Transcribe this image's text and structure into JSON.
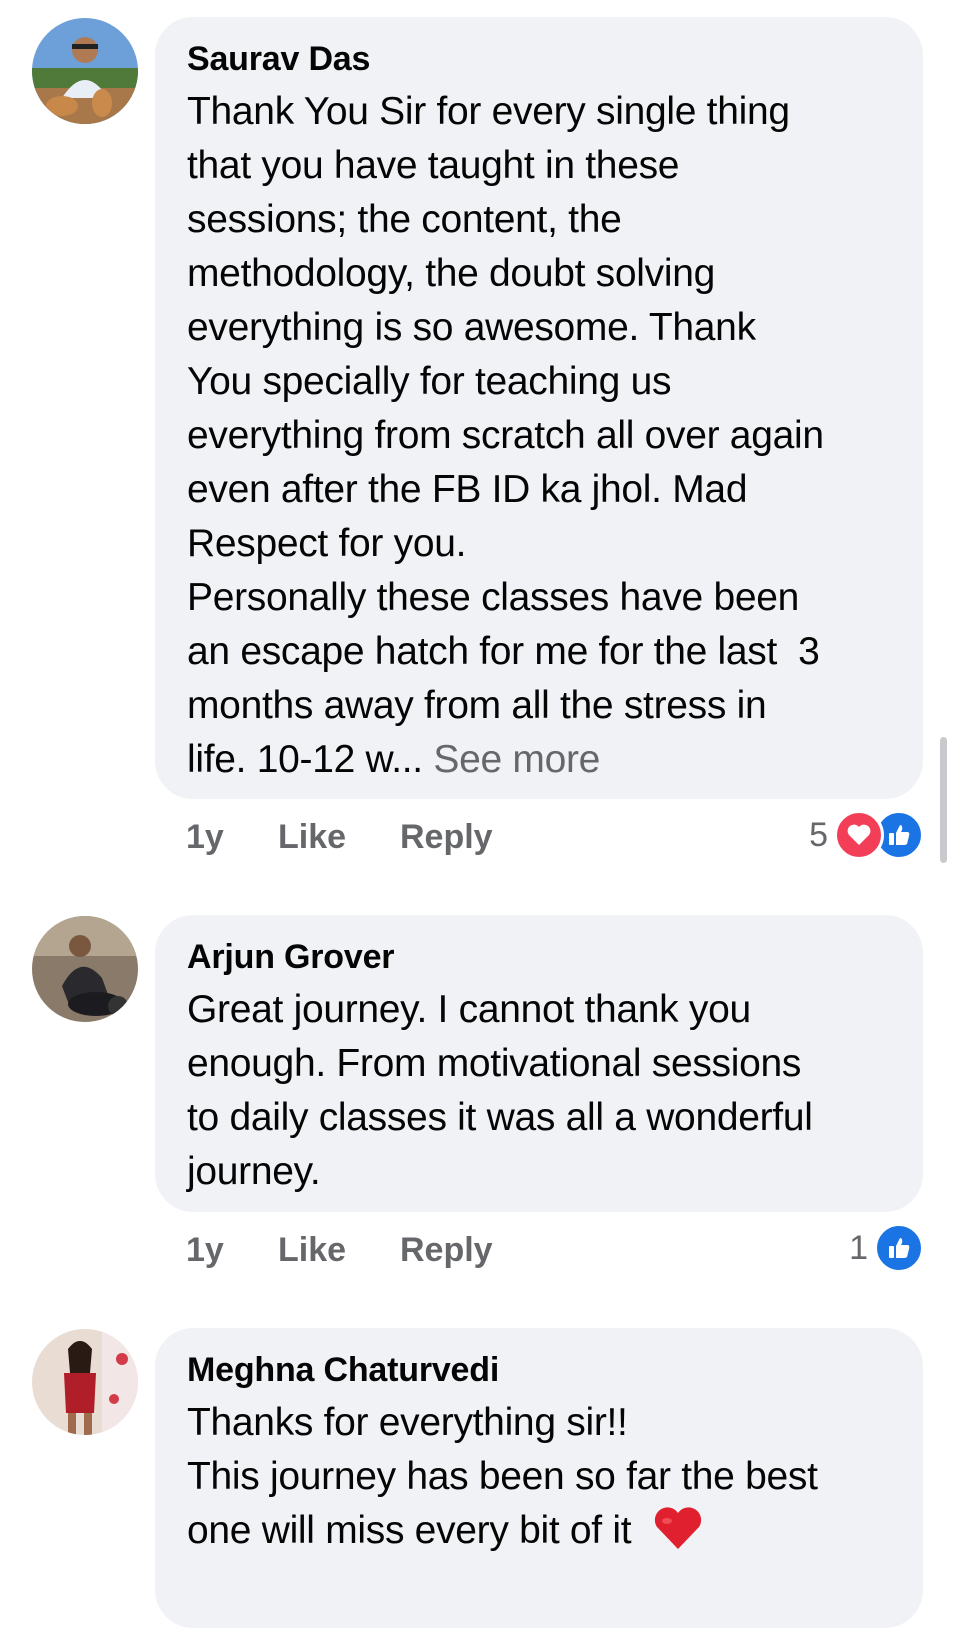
{
  "comments": [
    {
      "author": "Saurav Das",
      "lines": [
        "Thank You Sir for every single thing",
        "that you have taught in these",
        "sessions; the content, the",
        "methodology, the doubt solving",
        "everything is so awesome. Thank",
        "You specially for teaching us",
        "everything from scratch all over again",
        "even after the FB ID ka jhol. Mad",
        "Respect for you.",
        "Personally these classes have been",
        "an escape hatch for me for the last  3",
        "months away from all the stress in"
      ],
      "last_line": "life. 10-12 w...",
      "see_more": "See more",
      "time": "1y",
      "like_label": "Like",
      "reply_label": "Reply",
      "reaction_count": "5",
      "reactions": [
        "love-icon",
        "like-icon"
      ]
    },
    {
      "author": "Arjun Grover",
      "lines": [
        "Great journey. I cannot thank you",
        "enough. From motivational sessions",
        "to daily classes it was all a wonderful",
        "journey."
      ],
      "time": "1y",
      "like_label": "Like",
      "reply_label": "Reply",
      "reaction_count": "1",
      "reactions": [
        "like-icon"
      ]
    },
    {
      "author": "Meghna Chaturvedi",
      "lines": [
        "Thanks for everything sir!!",
        "This journey has been so far the best"
      ],
      "last_line": "one will miss every bit of it",
      "emoji": "red-heart-emoji"
    }
  ],
  "colors": {
    "bubble": "#f0f2f5",
    "secondary_text": "#65676b",
    "love": "#f33e58",
    "like": "#1b74e4"
  }
}
